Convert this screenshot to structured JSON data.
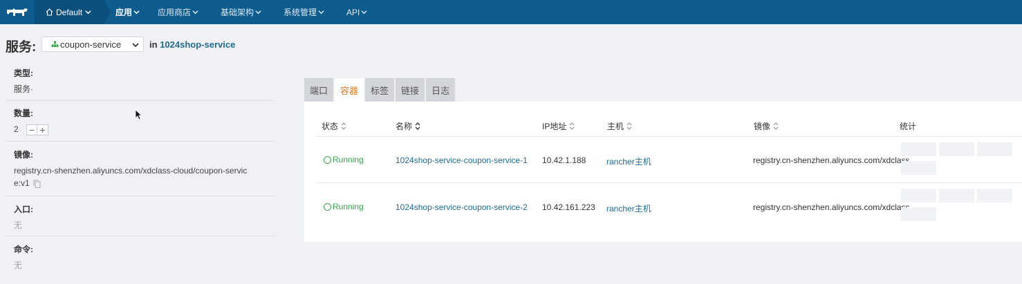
{
  "nav": {
    "environment": "Default",
    "items": [
      {
        "label": "应用",
        "active": true
      },
      {
        "label": "应用商店",
        "active": false
      },
      {
        "label": "基础架构",
        "active": false
      },
      {
        "label": "系统管理",
        "active": false
      },
      {
        "label": "API",
        "active": false
      }
    ]
  },
  "header": {
    "title": "服务:",
    "service_select": "coupon-service",
    "in_label": "in",
    "stack_name": "1024shop-service"
  },
  "sidebar": {
    "type_label": "类型:",
    "type_value": "服务·",
    "scale_label": "数量:",
    "scale_value": "2",
    "image_label": "镜像:",
    "image_value": "registry.cn-shenzhen.aliyuncs.com/xdclass-cloud/coupon-service:v1",
    "entry_label": "入口:",
    "entry_value": "无",
    "command_label": "命令:",
    "command_value": "无"
  },
  "tabs": [
    {
      "label": "端口",
      "active": false
    },
    {
      "label": "容器",
      "active": true
    },
    {
      "label": "标签",
      "active": false
    },
    {
      "label": "链接",
      "active": false
    },
    {
      "label": "日志",
      "active": false
    }
  ],
  "table": {
    "headers": {
      "state": "状态",
      "name": "名称",
      "ip": "IP地址",
      "host": "主机",
      "image": "镜像",
      "stats": "统计"
    },
    "rows": [
      {
        "state": "Running",
        "name": "1024shop-service-coupon-service-1",
        "ip": "10.42.1.188",
        "host": "rancher主机",
        "image": "registry.cn-shenzhen.aliyuncs.com/xdclass"
      },
      {
        "state": "Running",
        "name": "1024shop-service-coupon-service-2",
        "ip": "10.42.161.223",
        "host": "rancher主机",
        "image": "registry.cn-shenzhen.aliyuncs.com/xdclass"
      }
    ]
  },
  "colors": {
    "nav_bg": "#0e5c8e",
    "link": "#1f6b8f",
    "running": "#3aa34f",
    "active_tab": "#e07a1f"
  }
}
